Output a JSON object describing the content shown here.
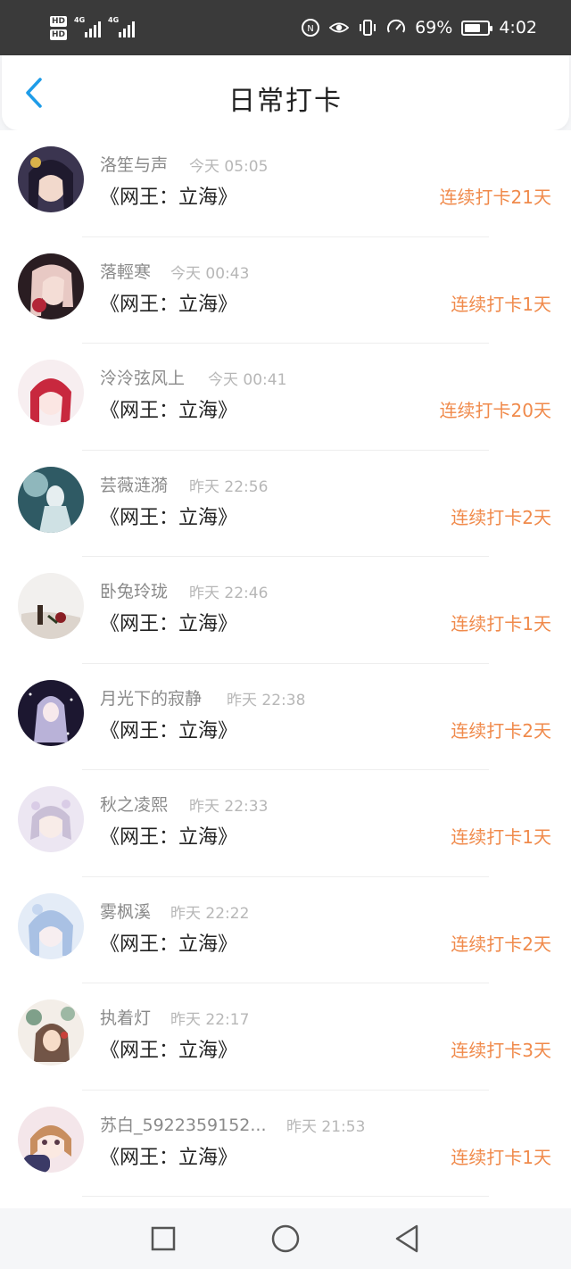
{
  "status_bar": {
    "hd1": "HD",
    "hd2": "HD",
    "net1": "4G",
    "net2": "4G",
    "battery_percent": "69%",
    "battery_level": 0.69,
    "time": "4:02",
    "icons": [
      "nfc-icon",
      "eye-icon",
      "vibrate-icon",
      "speed-icon"
    ]
  },
  "header": {
    "title": "日常打卡",
    "back_icon": "chevron-left-icon",
    "accent": "#1e9ce8"
  },
  "colors": {
    "streak": "#f08a4b",
    "name": "#8a8a8a",
    "time": "#b7b7b7"
  },
  "entries": [
    {
      "name": "洛笙与声",
      "time": "今天 05:05",
      "book": "《网王：立海》",
      "streak": "连续打卡21天"
    },
    {
      "name": "落輕寒",
      "time": "今天 00:43",
      "book": "《网王：立海》",
      "streak": "连续打卡1天"
    },
    {
      "name": "泠泠弦风上",
      "time": "今天 00:41",
      "book": "《网王：立海》",
      "streak": "连续打卡20天"
    },
    {
      "name": "芸薇涟漪",
      "time": "昨天 22:56",
      "book": "《网王：立海》",
      "streak": "连续打卡2天"
    },
    {
      "name": "卧兔玲珑",
      "time": "昨天 22:46",
      "book": "《网王：立海》",
      "streak": "连续打卡1天"
    },
    {
      "name": "月光下的寂静",
      "time": "昨天 22:38",
      "book": "《网王：立海》",
      "streak": "连续打卡2天"
    },
    {
      "name": "秋之凌熙",
      "time": "昨天 22:33",
      "book": "《网王：立海》",
      "streak": "连续打卡1天"
    },
    {
      "name": "雾枫溪",
      "time": "昨天 22:22",
      "book": "《网王：立海》",
      "streak": "连续打卡2天"
    },
    {
      "name": "执着灯",
      "time": "昨天 22:17",
      "book": "《网王：立海》",
      "streak": "连续打卡3天"
    },
    {
      "name": "苏白_5922359152...",
      "time": "昨天 21:53",
      "book": "《网王：立海》",
      "streak": "连续打卡1天"
    }
  ],
  "nav": {
    "recent": "square-icon",
    "home": "circle-icon",
    "back": "triangle-back-icon"
  }
}
